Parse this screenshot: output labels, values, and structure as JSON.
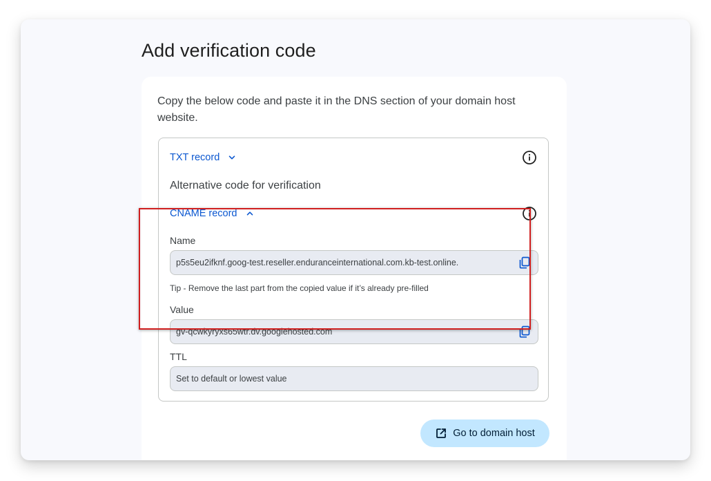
{
  "page": {
    "title": "Add verification code"
  },
  "card": {
    "instructions": "Copy the below code and paste it in the DNS section of your domain host website.",
    "txt_record": {
      "label": "TXT record",
      "expanded": false,
      "chevron_icon": "chevron-down-icon",
      "info_icon": "info-icon"
    },
    "alternative_label": "Alternative code for verification",
    "cname_record": {
      "label": "CNAME record",
      "expanded": true,
      "chevron_icon": "chevron-up-icon",
      "info_icon": "info-icon"
    },
    "name_field": {
      "label": "Name",
      "value": "p5s5eu2ifknf.goog-test.reseller.enduranceinternational.com.kb-test.online.",
      "copy_icon": "copy-icon"
    },
    "tip": "Tip - Remove the last part from the copied value if it’s already pre-filled",
    "value_field": {
      "label": "Value",
      "value": "gv-qcwkyryxs65wtr.dv.googlehosted.com",
      "copy_icon": "copy-icon"
    },
    "ttl_field": {
      "label": "TTL",
      "value": "Set to default or lowest value"
    },
    "go_button": {
      "label": "Go to domain host",
      "icon": "open-in-new-icon"
    }
  },
  "colors": {
    "link_blue": "#0b57d0",
    "highlight_red": "#d01f1f",
    "button_bg": "#c2e7ff",
    "field_bg": "#e8ebf2",
    "panel_bg": "#f8f9fd"
  }
}
